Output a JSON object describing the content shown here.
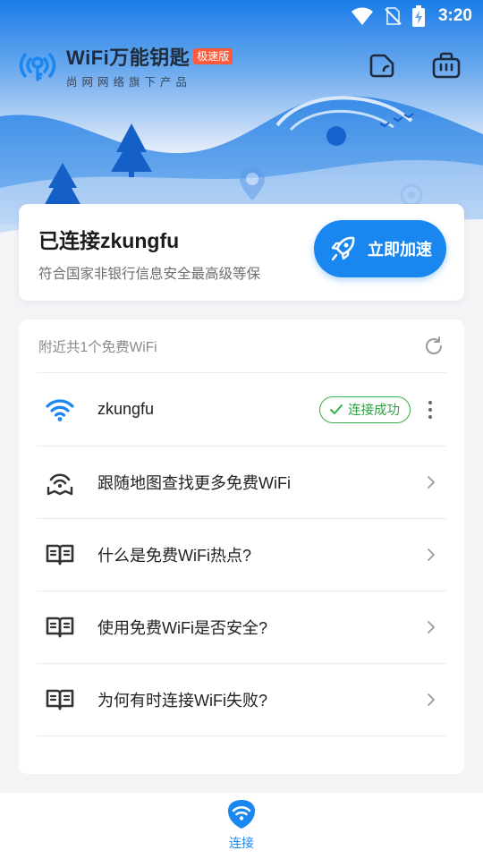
{
  "status_bar": {
    "time": "3:20"
  },
  "app": {
    "brand_name": "WiFi万能钥匙",
    "brand_badge": "极速版",
    "brand_sub": "尚网网络旗下产品"
  },
  "connection": {
    "title": "已连接zkungfu",
    "subtitle": "符合国家非银行信息安全最高级等保",
    "speed_button_label": "立即加速"
  },
  "nearby": {
    "header": "附近共1个免费WiFi",
    "networks": [
      {
        "ssid": "zkungfu",
        "status": "连接成功"
      }
    ],
    "items": [
      {
        "label": "跟随地图查找更多免费WiFi",
        "icon": "map-wifi-icon"
      },
      {
        "label": "什么是免费WiFi热点?",
        "icon": "book-icon"
      },
      {
        "label": "使用免费WiFi是否安全?",
        "icon": "book-icon"
      },
      {
        "label": "为何有时连接WiFi失败?",
        "icon": "book-icon"
      }
    ]
  },
  "bottom_nav": {
    "items": [
      {
        "label": "连接",
        "active": true
      }
    ]
  },
  "colors": {
    "accent": "#1a86f0",
    "success": "#35b04a",
    "badge": "#ff5a3c"
  }
}
